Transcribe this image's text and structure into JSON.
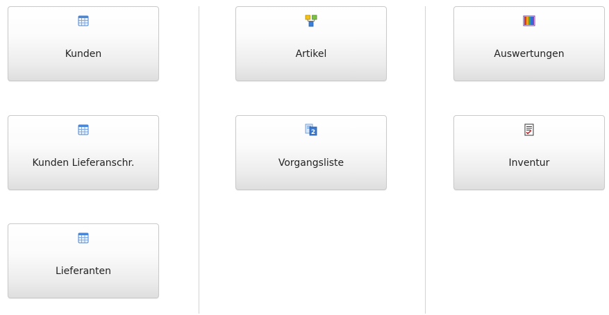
{
  "columns": [
    {
      "tiles": [
        {
          "label": "Kunden",
          "icon": "table-icon"
        },
        {
          "label": "Kunden Lieferanschr.",
          "icon": "table-icon"
        },
        {
          "label": "Lieferanten",
          "icon": "table-icon"
        }
      ]
    },
    {
      "tiles": [
        {
          "label": "Artikel",
          "icon": "hierarchy-icon"
        },
        {
          "label": "Vorgangsliste",
          "icon": "document-list-icon"
        }
      ]
    },
    {
      "tiles": [
        {
          "label": "Auswertungen",
          "icon": "color-bars-icon"
        },
        {
          "label": "Inventur",
          "icon": "checklist-icon"
        }
      ]
    }
  ],
  "colors": {
    "tile_border": "#c9c9c9",
    "divider": "#d2d2d2",
    "label_text": "#222222",
    "table_icon_blue": "#4a86d6"
  }
}
